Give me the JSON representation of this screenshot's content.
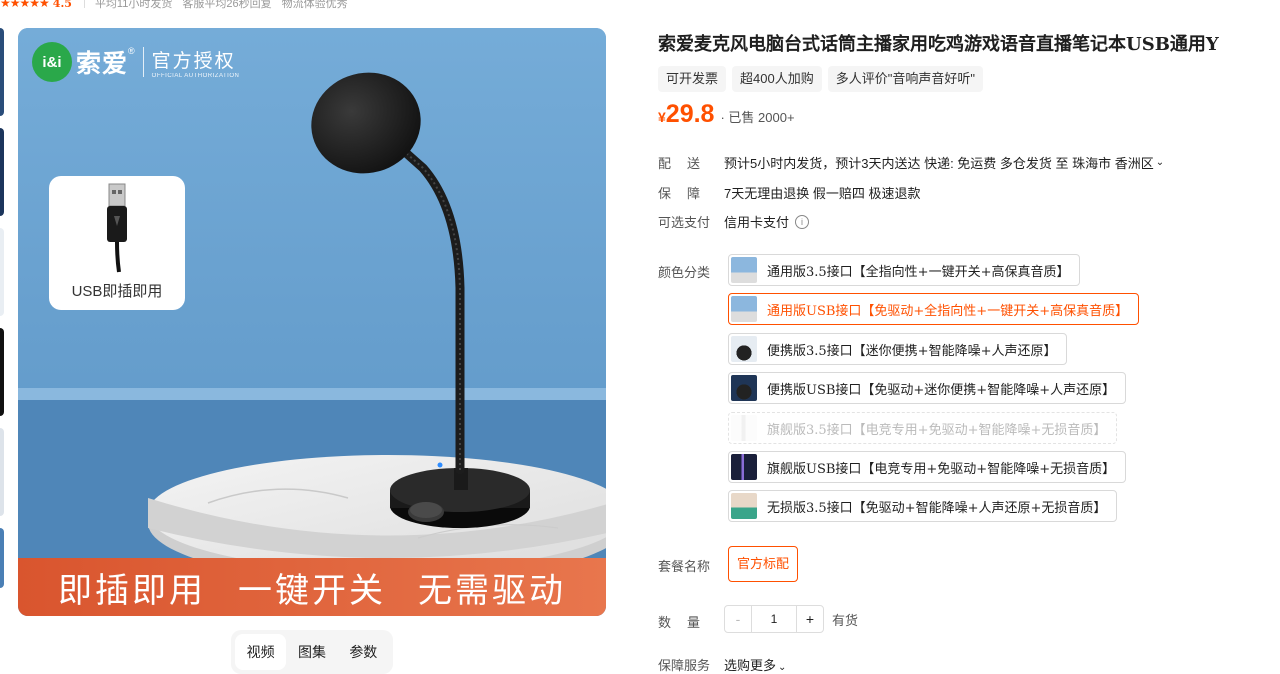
{
  "rating": {
    "stars": "★★★★★",
    "value": "4.5",
    "stats": [
      "平均11小时发货",
      "客服平均26秒回复",
      "物流体验优秀"
    ]
  },
  "gallery": {
    "brand_logo": "i&i",
    "brand_name": "索爱",
    "brand_reg": "®",
    "auth_cn": "官方授权",
    "auth_en": "OFFICIAL AUTHORIZATION",
    "usb_card_label": "USB即插即用",
    "mic_brand_mark": "索爱",
    "banner": [
      "即插即用",
      "一键开关",
      "无需驱动"
    ],
    "tabs": [
      {
        "label": "视频",
        "active": true
      },
      {
        "label": "图集",
        "active": false
      },
      {
        "label": "参数",
        "active": false
      }
    ]
  },
  "product": {
    "title": "索爱麦克风电脑台式话筒主播家用吃鸡游戏语音直播笔记本USB通用Y",
    "tags": [
      "可开发票",
      "超400人加购",
      "多人评价\"音响声音好听\""
    ],
    "currency": "¥",
    "price": "29.8",
    "sold": "· 已售 2000+",
    "accent_color": "#ff5000"
  },
  "delivery": {
    "label": "配送",
    "text": "预计5小时内发货，预计3天内送达  快递: 免运费  多仓发货  至  珠海市 香洲区",
    "chevron_icon": "chevron-down-icon"
  },
  "guarantee": {
    "label": "保障",
    "text": "7天无理由退换 假一赔四 极速退款"
  },
  "payment": {
    "label": "可选支付",
    "text": "信用卡支付",
    "info_icon": "info-icon"
  },
  "color_options": {
    "label": "颜色分类",
    "items": [
      {
        "label": "通用版3.5接口【全指向性+一键开关+高保真音质】",
        "state": "normal"
      },
      {
        "label": "通用版USB接口【免驱动+全指向性+一键开关+高保真音质】",
        "state": "selected"
      },
      {
        "label": "便携版3.5接口【迷你便携+智能降噪+人声还原】",
        "state": "normal"
      },
      {
        "label": "便携版USB接口【免驱动+迷你便携+智能降噪+人声还原】",
        "state": "normal"
      },
      {
        "label": "旗舰版3.5接口【电竞专用+免驱动+智能降噪+无损音质】",
        "state": "disabled"
      },
      {
        "label": "旗舰版USB接口【电竞专用+免驱动+智能降噪+无损音质】",
        "state": "normal"
      },
      {
        "label": "无损版3.5接口【免驱动+智能降噪+人声还原+无损音质】",
        "state": "normal"
      }
    ]
  },
  "package": {
    "label": "套餐名称",
    "option": "官方标配"
  },
  "quantity": {
    "label": "数量",
    "minus": "-",
    "value": "1",
    "plus": "+",
    "stock": "有货"
  },
  "service": {
    "label": "保障服务",
    "value": "选购更多"
  }
}
